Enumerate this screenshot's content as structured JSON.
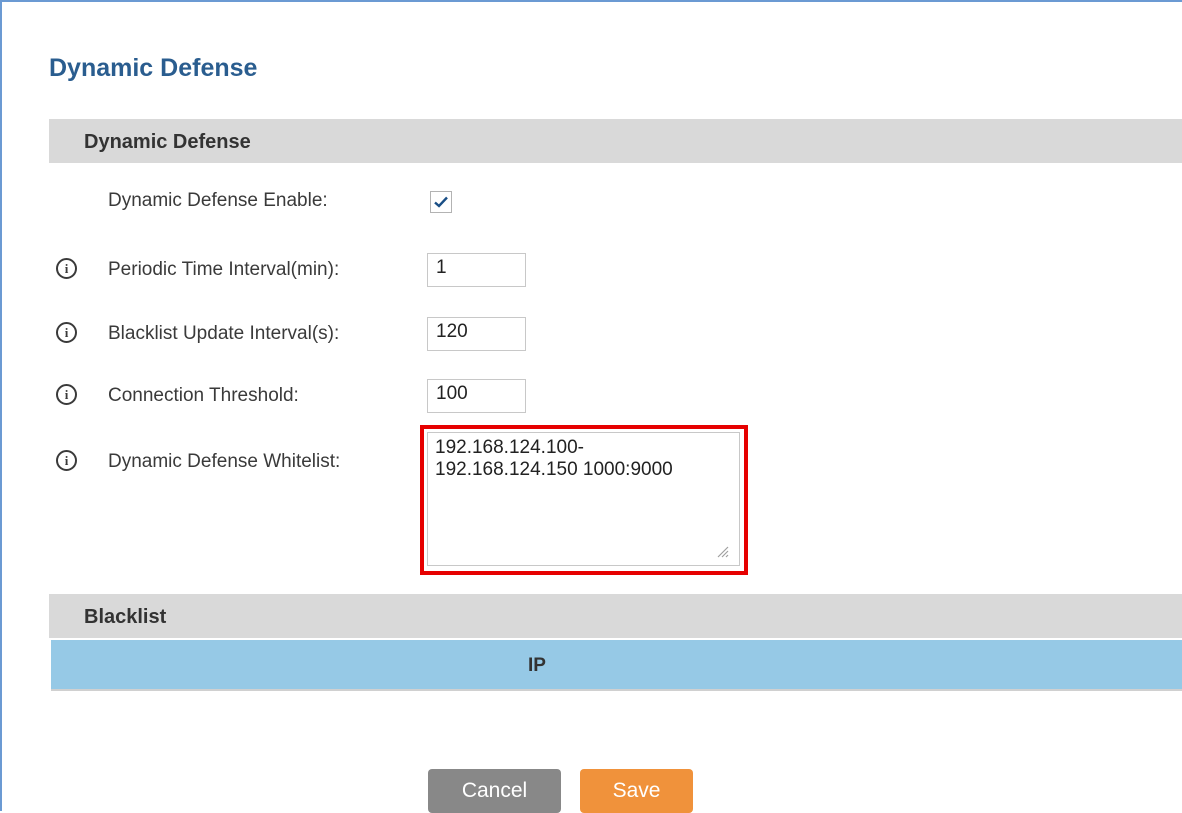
{
  "page": {
    "title": "Dynamic Defense"
  },
  "section_dynamic": {
    "header": "Dynamic Defense",
    "fields": {
      "enable": {
        "label": "Dynamic Defense Enable:",
        "checked": true
      },
      "periodic_interval": {
        "label": "Periodic Time Interval(min):",
        "value": "1"
      },
      "blacklist_interval": {
        "label": "Blacklist Update Interval(s):",
        "value": "120"
      },
      "threshold": {
        "label": "Connection Threshold:",
        "value": "100"
      },
      "whitelist": {
        "label": "Dynamic Defense Whitelist:",
        "value": "192.168.124.100-\n192.168.124.150 1000:9000"
      }
    }
  },
  "section_blacklist": {
    "header": "Blacklist",
    "table": {
      "columns": [
        "IP"
      ]
    }
  },
  "buttons": {
    "cancel": "Cancel",
    "save": "Save"
  },
  "icons": {
    "info": "info-icon",
    "check": "checkmark-icon"
  },
  "colors": {
    "title": "#2a5d8f",
    "section_header_bg": "#d9d9d9",
    "table_header_bg": "#96c9e6",
    "highlight": "#e60000",
    "cancel_bg": "#888888",
    "save_bg": "#f0923b"
  }
}
